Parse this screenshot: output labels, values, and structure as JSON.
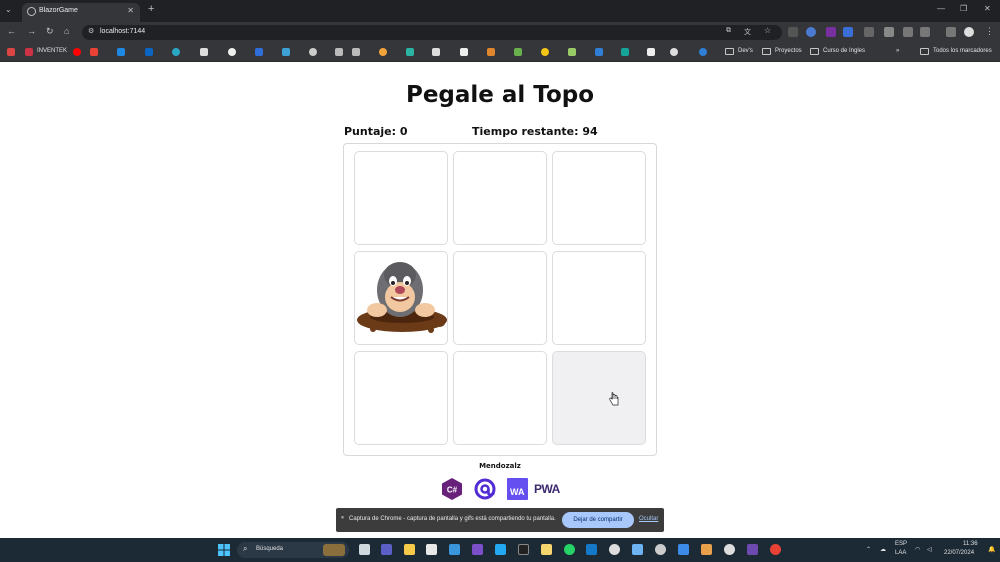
{
  "browser": {
    "tab_title": "BlazorGame",
    "url": "localhost:7144",
    "bookmarks": {
      "inventek": "INVENTEK",
      "folders": [
        "Dev's",
        "Proyectos",
        "Curso de Ingles"
      ],
      "all_bookmarks": "Todos los marcadores"
    }
  },
  "game": {
    "title": "Pegale al Topo",
    "score_text": "Puntaje: 0",
    "time_text": "Tiempo restante: 94",
    "active_hole_index": 3,
    "hovered_hole_index": 8,
    "author": "Mendozalz",
    "tech_logos": [
      "csharp-logo",
      "blazor-logo",
      "webassembly-logo",
      "pwa-logo"
    ],
    "wa_label": "WA",
    "pwa_label": "PWA"
  },
  "share_bar": {
    "message": "Captura de Chrome - captura de pantalla y gifs está compartiendo tu pantalla.",
    "stop_label": "Dejar de compartir",
    "hide_label": "Ocultar"
  },
  "taskbar": {
    "search_label": "Búsqueda",
    "lang_top": "ESP",
    "lang_bottom": "LAA",
    "time": "11:36",
    "date": "22/07/2024"
  },
  "colors": {
    "mole_body": "#6e6e72",
    "dirt": "#6b3a17",
    "csharp": "#68217a",
    "blazor": "#512bd4",
    "webassembly": "#654ff0"
  }
}
